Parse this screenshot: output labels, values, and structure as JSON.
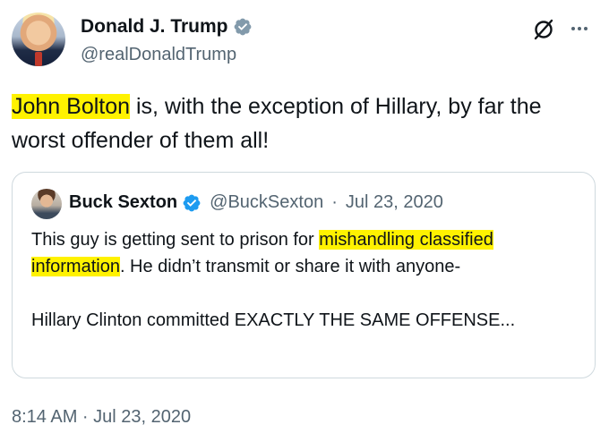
{
  "author": {
    "name": "Donald J. Trump",
    "handle": "@realDonaldTrump"
  },
  "tweet": {
    "highlight": "John Bolton",
    "text_rest": " is, with the exception of Hillary, by far the worst offender of them all!"
  },
  "quoted": {
    "name": "Buck Sexton",
    "handle": "@BuckSexton",
    "separator": "·",
    "date": "Jul 23, 2020",
    "line1_before": "This guy is getting sent to prison for ",
    "line1_highlight": "mishandling classified information",
    "line1_after": ". He didn’t transmit or share it with anyone-",
    "line2": "Hillary Clinton committed EXACTLY THE SAME OFFENSE..."
  },
  "timestamp": "8:14 AM · Jul 23, 2020",
  "icons": {
    "verified": "verified-badge-icon",
    "grok": "grok-icon",
    "more": "more-icon"
  },
  "colors": {
    "verified": "#829aab",
    "highlight": "#fff200",
    "secondary_text": "#536471"
  }
}
